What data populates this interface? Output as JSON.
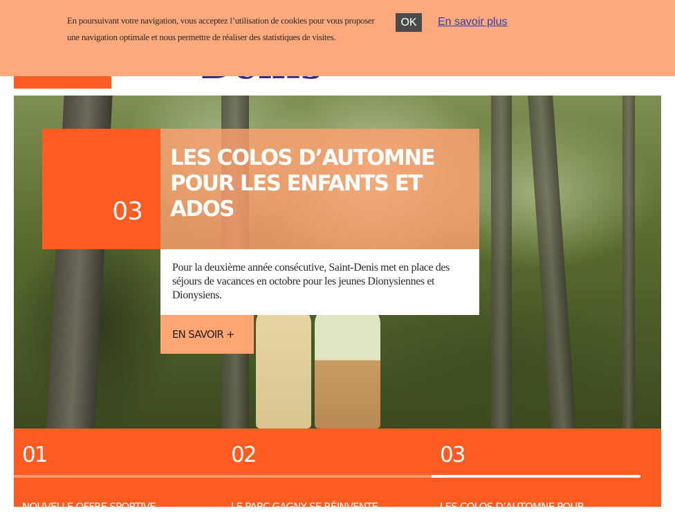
{
  "header": {
    "logo_text": "Denis"
  },
  "cookie": {
    "text": "En poursuivant votre navigation, vous acceptez l’utilisation de cookies pour vous proposer une navigation optimale et nous permettre de réaliser des statistiques de visites.",
    "ok_label": "OK",
    "more_label": "En savoir plus"
  },
  "hero": {
    "number": "03",
    "title_line1": "LES COLOS D’AUTOMNE",
    "title_line2": "POUR LES ENFANTS ET ADOS",
    "description": "Pour la deuxième année consécutive, Saint-Denis met en place des séjours de vacances en octobre pour les jeunes Dionysiennes et Dionysiens.",
    "cta_label": "EN SAVOIR +"
  },
  "slider_nav": {
    "items": [
      {
        "number": "01",
        "caption": "NOUVELLE OFFRE SPORTIVE",
        "active": false
      },
      {
        "number": "02",
        "caption": "LE PARC GAGNY SE RÉINVENTE",
        "active": false
      },
      {
        "number": "03",
        "caption": "LES COLOS D’AUTOMNE POUR",
        "active": true
      }
    ]
  },
  "colors": {
    "brand_orange": "#ff5c21",
    "cookie_bg": "#fea97d",
    "logo_blue": "#2b2f8f"
  }
}
